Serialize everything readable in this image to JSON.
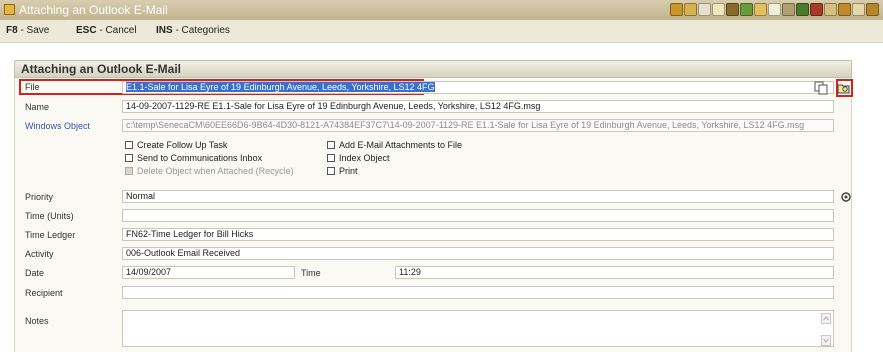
{
  "window": {
    "title": "Attaching an Outlook E-Mail",
    "toolbar_icons": [
      "address-book-icon",
      "calendar-icon",
      "documents-icon",
      "mail-icon",
      "people-icon",
      "chart-icon",
      "folder-icon",
      "notes-icon",
      "report-icon",
      "settings-icon",
      "phone-icon",
      "tasks-icon",
      "home-icon",
      "print-icon",
      "help-icon"
    ]
  },
  "shortcuts": {
    "save_key": "F8",
    "save_label": "- Save",
    "cancel_key": "ESC",
    "cancel_label": "- Cancel",
    "categories_key": "INS",
    "categories_label": "- Categories"
  },
  "panel": {
    "header": "Attaching an Outlook E-Mail"
  },
  "form": {
    "file": {
      "label": "File",
      "value": "E1.1-Sale for Lisa Eyre of 19 Edinburgh Avenue, Leeds, Yorkshire, LS12 4FG"
    },
    "name": {
      "label": "Name",
      "value": "14-09-2007-1129-RE E1.1-Sale for Lisa Eyre of 19 Edinburgh Avenue, Leeds, Yorkshire, LS12 4FG.msg"
    },
    "windows_object": {
      "label": "Windows Object",
      "value": "c:\\temp\\SenecaCM\\60EE66D6-9B64-4D30-8121-A74384EF37C7\\14-09-2007-1129-RE E1.1-Sale for Lisa Eyre of 19 Edinburgh Avenue, Leeds, Yorkshire, LS12 4FG.msg"
    },
    "options": {
      "create_follow_up": "Create Follow Up Task",
      "send_to_comms": "Send to Communications Inbox",
      "delete_object": "Delete Object when Attached (Recycle)",
      "add_attachments": "Add E-Mail Attachments to File",
      "index_object": "Index Object",
      "print": "Print"
    },
    "priority": {
      "label": "Priority",
      "value": "Normal"
    },
    "time_units": {
      "label": "Time (Units)",
      "value": ""
    },
    "time_ledger": {
      "label": "Time Ledger",
      "value": "FN62-Time Ledger for Bill Hicks"
    },
    "activity": {
      "label": "Activity",
      "value": "006-Outlook Email Received"
    },
    "date": {
      "label": "Date",
      "value": "14/09/2007"
    },
    "time": {
      "label": "Time",
      "value": "11:29"
    },
    "recipient": {
      "label": "Recipient",
      "value": ""
    },
    "notes": {
      "label": "Notes",
      "value": ""
    }
  },
  "colors": {
    "highlight": "#d42020",
    "selection": "#3a6fd0",
    "link": "#3355aa"
  }
}
